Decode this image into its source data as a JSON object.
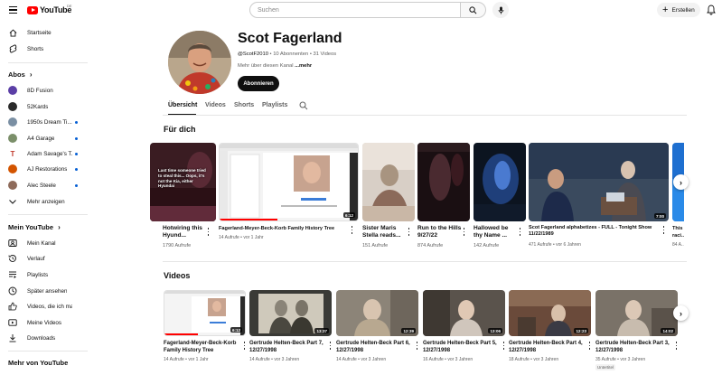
{
  "topbar": {
    "logo_text": "YouTube",
    "logo_region": "DE",
    "search_placeholder": "Suchen",
    "create_label": "Erstellen"
  },
  "sidebar": {
    "main": [
      {
        "label": "Startseite",
        "icon": "home-icon"
      },
      {
        "label": "Shorts",
        "icon": "shorts-icon"
      }
    ],
    "subs_header": "Abos",
    "subscriptions": [
      {
        "label": "8D Fusion",
        "color": "#5b3fa6",
        "dot": false
      },
      {
        "label": "52Kards",
        "color": "#2a2a2a",
        "dot": false
      },
      {
        "label": "1950s Dream Ti...",
        "color": "#7a8fa3",
        "dot": true
      },
      {
        "label": "A4 Garage",
        "color": "#7b8f6a",
        "dot": true
      },
      {
        "label": "Adam Savage's T...",
        "color": "#c0392b",
        "dot": true
      },
      {
        "label": "AJ Restorations",
        "color": "#d35400",
        "dot": true
      },
      {
        "label": "Alec Steele",
        "color": "#8e6b5a",
        "dot": true
      }
    ],
    "show_more": "Mehr anzeigen",
    "you_header": "Mein YouTube",
    "you_items": [
      {
        "label": "Mein Kanal",
        "icon": "channel-icon"
      },
      {
        "label": "Verlauf",
        "icon": "history-icon"
      },
      {
        "label": "Playlists",
        "icon": "playlists-icon"
      },
      {
        "label": "Später ansehen",
        "icon": "watch-later-icon"
      },
      {
        "label": "Videos, die ich mag",
        "icon": "like-icon"
      },
      {
        "label": "Meine Videos",
        "icon": "my-videos-icon"
      },
      {
        "label": "Downloads",
        "icon": "download-icon"
      }
    ],
    "more_header": "Mehr von YouTube"
  },
  "channel": {
    "name": "Scot Fagerland",
    "handle": "@ScotF2010",
    "subscribers": "10 Abonnenten",
    "videos": "31 Videos",
    "about_prefix": "Mehr über diesen Kanal ",
    "about_more": "...mehr",
    "subscribe_label": "Abonnieren"
  },
  "tabs": [
    "Übersicht",
    "Videos",
    "Shorts",
    "Playlists"
  ],
  "for_you": {
    "title": "Für dich",
    "items": [
      {
        "title": "Hotwiring this Hyund...",
        "meta": "1790 Aufrufe",
        "duration": "",
        "overlay": "Last time someone tried to steal this... Oops, it's not the Kia, either Hyundai"
      },
      {
        "title": "Fagerland-Meyer-Beck-Korb Family History Tree",
        "meta": "14 Aufrufe • vor 1 Jahr",
        "duration": "6:12"
      },
      {
        "title": "Sister Maris Stella reads...",
        "meta": "151 Aufrufe",
        "duration": ""
      },
      {
        "title": "Run to the Hills 9/27/22",
        "meta": "874 Aufrufe",
        "duration": ""
      },
      {
        "title": "Hallowed be thy Name ...",
        "meta": "142 Aufrufe",
        "duration": ""
      },
      {
        "title": "Scot Fagerland alphabetizes - FULL - Tonight Show 11/22/1989",
        "meta": "471 Aufrufe • vor 6 Jahren",
        "duration": "7:00"
      },
      {
        "title": "This raci...",
        "meta": "84 A...",
        "duration": ""
      }
    ]
  },
  "videos": {
    "title": "Videos",
    "items": [
      {
        "title": "Fagerland-Meyer-Beck-Korb Family History Tree",
        "meta": "14 Aufrufe • vor 1 Jahr",
        "duration": "6:12"
      },
      {
        "title": "Gertrude Helten-Beck Part 7, 12/27/1998",
        "meta": "14 Aufrufe • vor 3 Jahren",
        "duration": "13:37"
      },
      {
        "title": "Gertrude Helten-Beck Part 6, 12/27/1998",
        "meta": "14 Aufrufe • vor 3 Jahren",
        "duration": "12:39"
      },
      {
        "title": "Gertrude Helten-Beck Part 5, 12/27/1998",
        "meta": "16 Aufrufe • vor 3 Jahren",
        "duration": "13:06"
      },
      {
        "title": "Gertrude Helten-Beck Part 4, 12/27/1998",
        "meta": "18 Aufrufe • vor 3 Jahren",
        "duration": "12:23"
      },
      {
        "title": "Gertrude Helten-Beck Part 3, 12/27/1998",
        "meta": "35 Aufrufe • vor 3 Jahren",
        "duration": "14:02",
        "badge": "Untertitel"
      }
    ]
  }
}
